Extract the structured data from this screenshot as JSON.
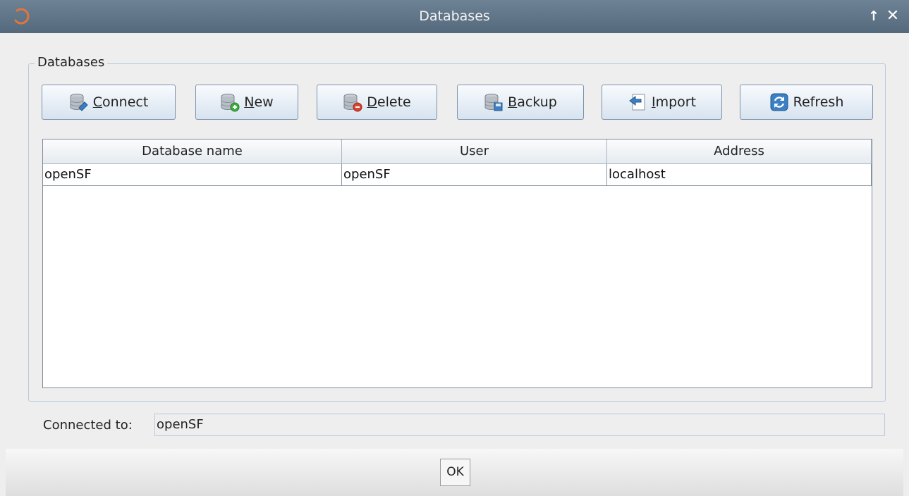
{
  "window": {
    "title": "Databases"
  },
  "group": {
    "legend": "Databases"
  },
  "toolbar": {
    "connect": "Connect",
    "new": "New",
    "delete": "Delete",
    "backup": "Backup",
    "import": "Import",
    "refresh": "Refresh"
  },
  "table": {
    "columns": [
      "Database name",
      "User",
      "Address"
    ],
    "rows": [
      [
        "openSF",
        "openSF",
        "localhost"
      ]
    ]
  },
  "status": {
    "label": "Connected to:",
    "value": "openSF"
  },
  "footer": {
    "ok": "OK"
  },
  "icons": {
    "connect": "database-connect-icon",
    "new": "database-add-icon",
    "delete": "database-remove-icon",
    "backup": "database-backup-icon",
    "import": "import-icon",
    "refresh": "refresh-icon"
  },
  "colors": {
    "titlebar": "#5f7388",
    "group_border": "#b9c9dc",
    "button_border": "#7d93ab"
  }
}
